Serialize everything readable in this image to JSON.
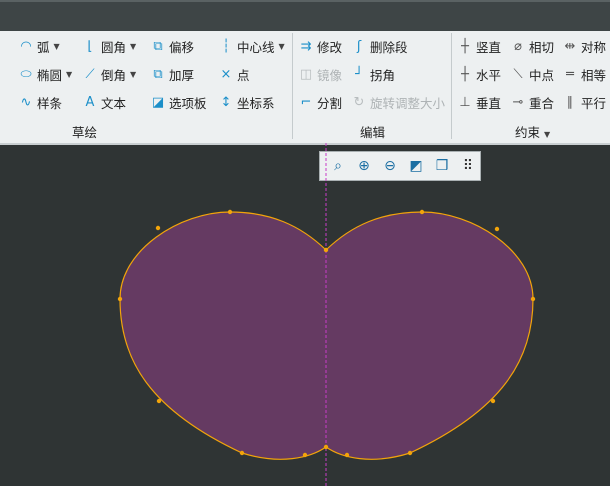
{
  "sketch": {
    "label": "草绘",
    "items": [
      {
        "label": "弧",
        "icon": "arc-icon",
        "dropdown": true
      },
      {
        "label": "圆角",
        "icon": "fillet-icon",
        "dropdown": true
      },
      {
        "label": "偏移",
        "icon": "offset-icon"
      },
      {
        "label": "中心线",
        "icon": "centerline-icon",
        "dropdown": true
      },
      {
        "label": "椭圆",
        "icon": "ellipse-icon",
        "dropdown": true
      },
      {
        "label": "倒角",
        "icon": "chamfer-icon",
        "dropdown": true
      },
      {
        "label": "加厚",
        "icon": "thicken-icon"
      },
      {
        "label": "点",
        "icon": "point-icon"
      },
      {
        "label": "样条",
        "icon": "spline-icon"
      },
      {
        "label": "文本",
        "icon": "text-icon"
      },
      {
        "label": "选项板",
        "icon": "palette-icon"
      },
      {
        "label": "坐标系",
        "icon": "coordinate-system-icon"
      }
    ]
  },
  "edit": {
    "label": "编辑",
    "items": [
      {
        "label": "修改",
        "icon": "modify-icon"
      },
      {
        "label": "删除段",
        "icon": "delete-segment-icon"
      },
      {
        "label": "镜像",
        "icon": "mirror-icon",
        "disabled": true
      },
      {
        "label": "拐角",
        "icon": "corner-icon"
      },
      {
        "label": "分割",
        "icon": "divide-icon"
      },
      {
        "label": "旋转调整大小",
        "icon": "rotate-resize-icon",
        "disabled": true
      }
    ]
  },
  "constrain": {
    "label": "约束",
    "items": [
      {
        "label": "竖直",
        "icon": "vertical-icon"
      },
      {
        "label": "相切",
        "icon": "tangent-icon"
      },
      {
        "label": "对称",
        "icon": "symmetric-icon"
      },
      {
        "label": "水平",
        "icon": "horizontal-icon"
      },
      {
        "label": "中点",
        "icon": "midpoint-icon"
      },
      {
        "label": "相等",
        "icon": "equal-icon"
      },
      {
        "label": "垂直",
        "icon": "perpendicular-icon"
      },
      {
        "label": "重合",
        "icon": "coincident-icon"
      },
      {
        "label": "平行",
        "icon": "parallel-icon"
      }
    ]
  },
  "graphics_toolbar": [
    "refit-icon",
    "zoom-in-icon",
    "zoom-out-icon",
    "display-style-icon",
    "saved-views-icon",
    "sketch-display-icon"
  ],
  "colors": {
    "fill": "#653a62",
    "outline": "#f2a40a",
    "centerline": "#c83cc8"
  }
}
